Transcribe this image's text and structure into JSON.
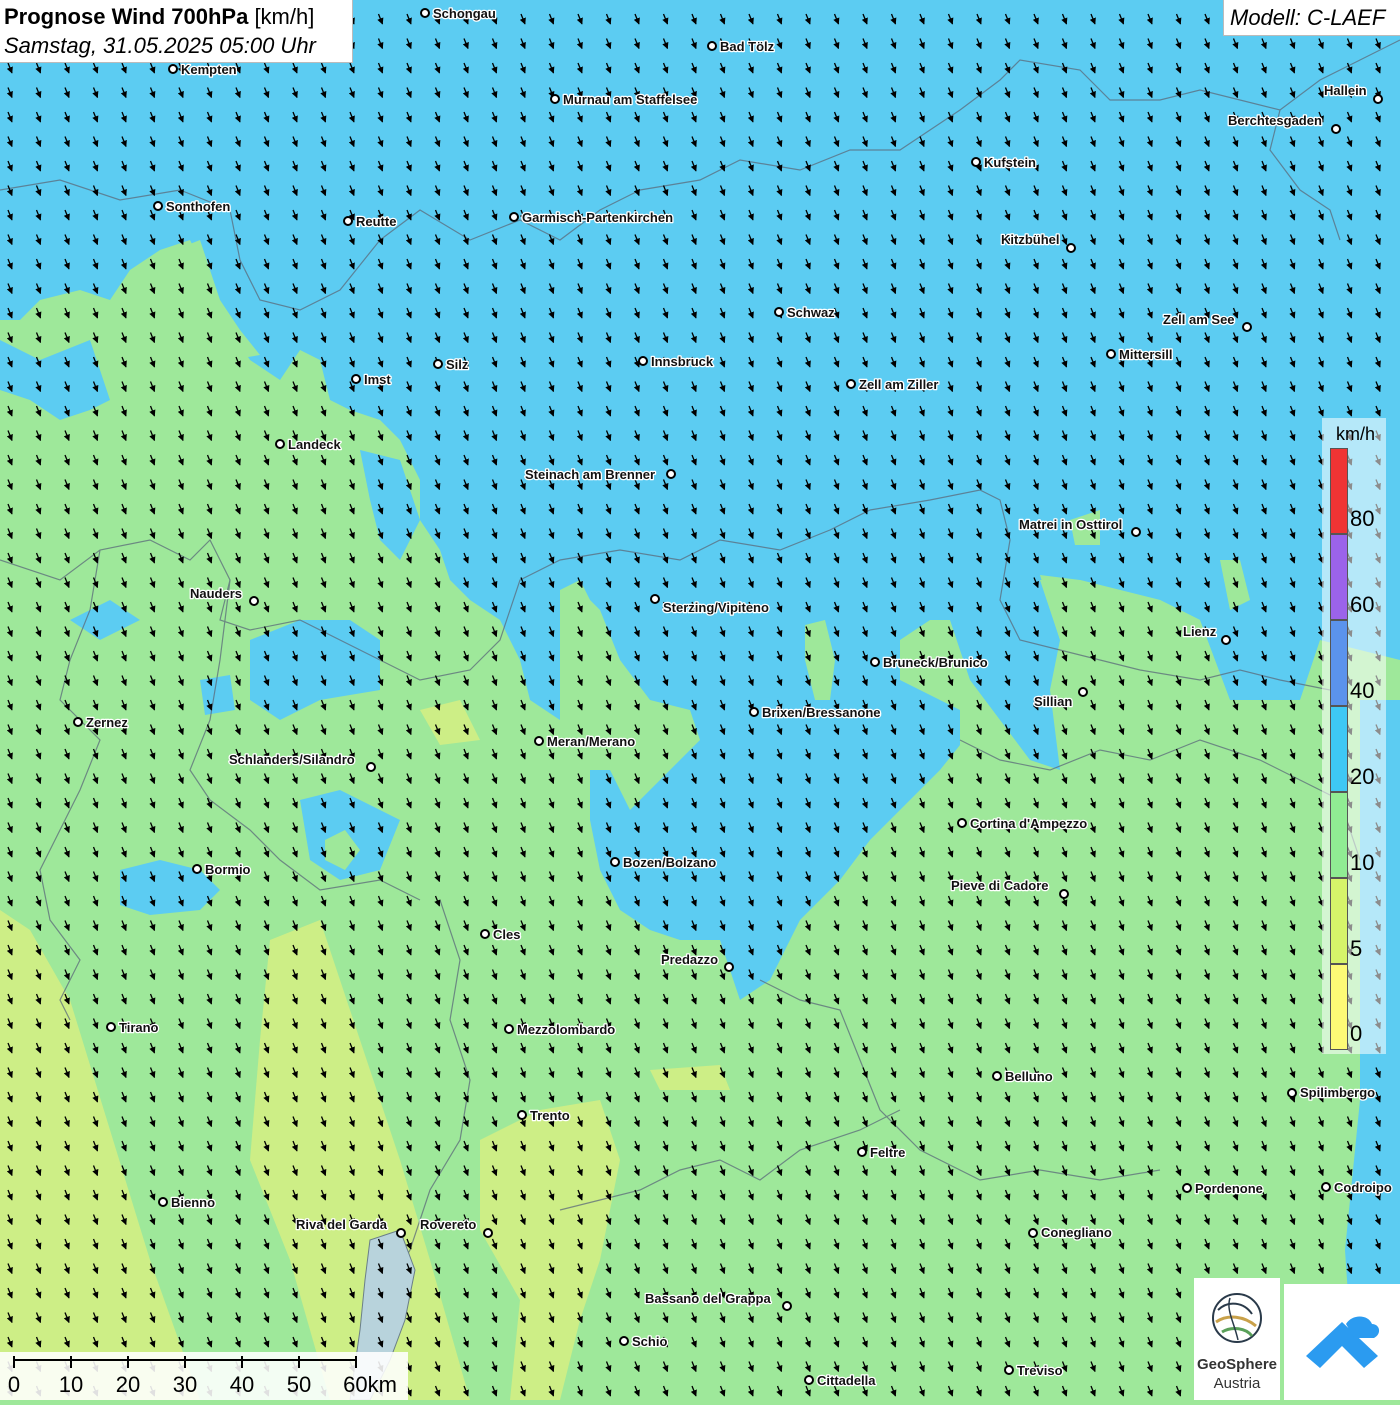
{
  "header": {
    "title_bold": "Prognose Wind 700hPa",
    "title_unit": "[km/h]",
    "datetime": "Samstag, 31.05.2025 05:00 Uhr"
  },
  "model": {
    "label": "Modell: C-LAEF"
  },
  "legend": {
    "unit": "km/h",
    "bins": [
      {
        "from": 0,
        "to": 5,
        "color": "#fdfa76"
      },
      {
        "from": 5,
        "to": 10,
        "color": "#d6f46a"
      },
      {
        "from": 10,
        "to": 20,
        "color": "#90ec93"
      },
      {
        "from": 20,
        "to": 40,
        "color": "#3ec8f4"
      },
      {
        "from": 40,
        "to": 60,
        "color": "#5b93ec"
      },
      {
        "from": 60,
        "to": 80,
        "color": "#9b63ea"
      },
      {
        "from": 80,
        "to": null,
        "color": "#ef3434"
      }
    ],
    "ticks": [
      "0",
      "5",
      "10",
      "20",
      "40",
      "60",
      "80"
    ]
  },
  "wind": {
    "direction": "from north-northwest",
    "arrow_color": "#000000"
  },
  "places": [
    "Schongau",
    "Bad Tölz",
    "Kempten",
    "Murnau am Staffelsee",
    "Hallein",
    "Berchtesgaden",
    "Kufstein",
    "Sonthofen",
    "Reutte",
    "Garmisch-Partenkirchen",
    "Kitzbühel",
    "Schwaz",
    "Zell am See",
    "Imst",
    "Silz",
    "Innsbruck",
    "Mittersill",
    "Zell am Ziller",
    "Landeck",
    "Steinach am Brenner",
    "Matrei in Osttirol",
    "Nauders",
    "Sterzing/Vipiteno",
    "Lienz",
    "Bruneck/Brunico",
    "Sillian",
    "Zernez",
    "Brixen/Bressanone",
    "Meran/Merano",
    "Schlanders/Silandro",
    "Cortina d'Ampezzo",
    "Bormio",
    "Bozen/Bolzano",
    "Pieve di Cadore",
    "Cles",
    "Predazzo",
    "Tirano",
    "Mezzolombardo",
    "Belluno",
    "Spilimbergo",
    "Trento",
    "Feltre",
    "Pordenone",
    "Codroipo",
    "Bienno",
    "Riva del Garda",
    "Rovereto",
    "Conegliano",
    "Bassano del Grappa",
    "Schio",
    "Treviso",
    "Cittadella"
  ],
  "scale": {
    "ticks": [
      "0",
      "10",
      "20",
      "30",
      "40",
      "50",
      "60km"
    ]
  },
  "logos": {
    "geosphere_line1": "GeoSphere",
    "geosphere_line2": "Austria"
  }
}
